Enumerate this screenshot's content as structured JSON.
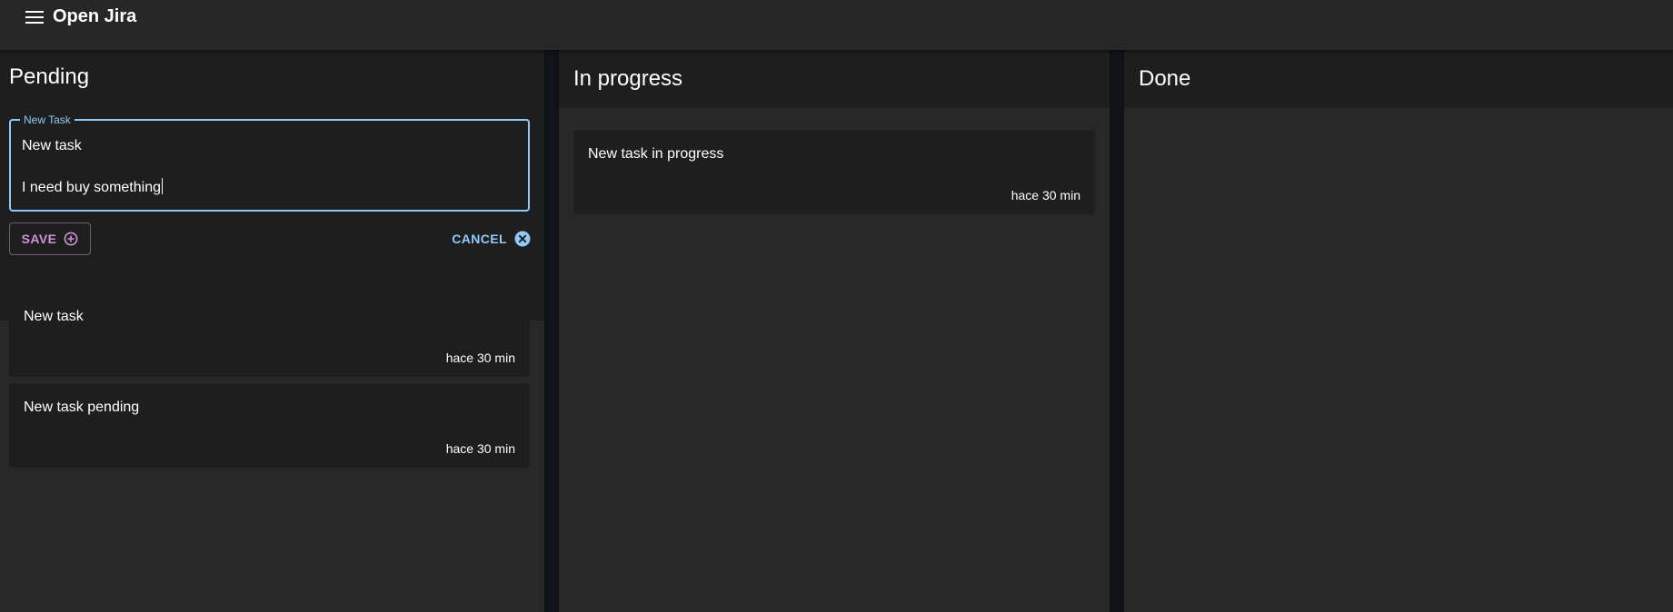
{
  "app": {
    "title": "Open Jira",
    "menu_icon": "hamburger-menu-icon"
  },
  "columns": {
    "pending": {
      "title": "Pending",
      "new_task": {
        "label": "New Task",
        "value": "New task\n\nI need buy something",
        "save_label": "SAVE",
        "save_icon": "add-circle-outline-icon",
        "cancel_label": "CANCEL",
        "cancel_icon": "cancel-circle-icon"
      },
      "cards": [
        {
          "title": "New task",
          "time": "hace 30 min"
        },
        {
          "title": "New task pending",
          "time": "hace 30 min"
        }
      ]
    },
    "in_progress": {
      "title": "In progress",
      "cards": [
        {
          "title": "New task in progress",
          "time": "hace 30 min"
        }
      ]
    },
    "done": {
      "title": "Done",
      "cards": []
    }
  },
  "colors": {
    "primary": "#90caf9",
    "secondary": "#ce93d8",
    "background": "#121212",
    "paper": "#1e1e1e"
  }
}
